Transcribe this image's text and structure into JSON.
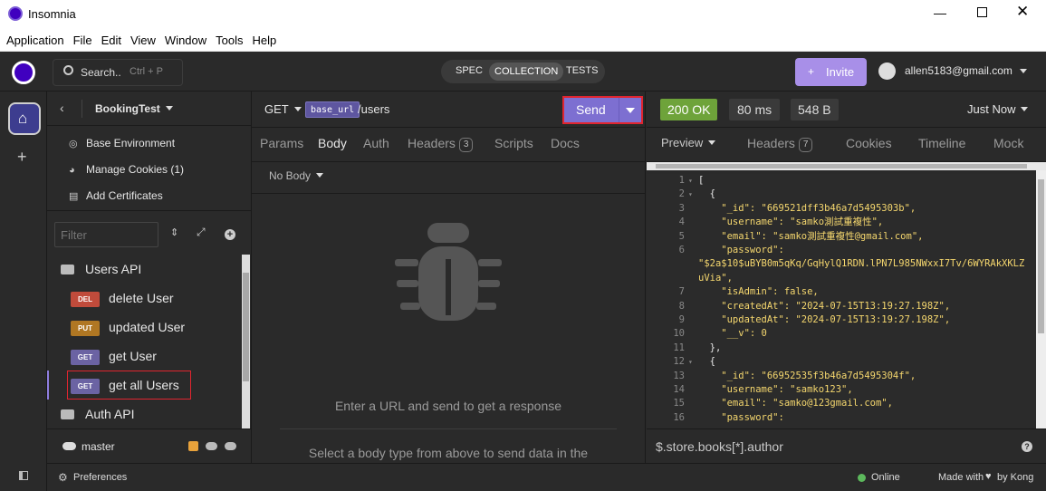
{
  "window": {
    "title": "Insomnia"
  },
  "menu": [
    "Application",
    "File",
    "Edit",
    "View",
    "Window",
    "Tools",
    "Help"
  ],
  "topbar": {
    "search_label": "Search..",
    "search_shortcut": "Ctrl + P",
    "modes": [
      "SPEC",
      "COLLECTION",
      "TESTS"
    ],
    "active_mode": "COLLECTION",
    "invite_label": "Invite",
    "user_email": "allen5183@gmail.com",
    "invite_color": "#a88fe8"
  },
  "sidebar": {
    "project_name": "BookingTest",
    "env_items": [
      {
        "icon": "globe-icon",
        "label": "Base Environment"
      },
      {
        "icon": "cookie-icon",
        "label": "Manage Cookies (1)"
      },
      {
        "icon": "certificate-icon",
        "label": "Add Certificates"
      }
    ],
    "filter_placeholder": "Filter",
    "folders": [
      {
        "name": "Users API",
        "requests": [
          {
            "method": "DEL",
            "name": "delete User"
          },
          {
            "method": "PUT",
            "name": "updated User"
          },
          {
            "method": "GET",
            "name": "get User"
          },
          {
            "method": "GET",
            "name": "get all Users",
            "active": true
          }
        ]
      },
      {
        "name": "Auth API",
        "requests": []
      }
    ],
    "branch": "master"
  },
  "request": {
    "method": "GET",
    "url_var": "base_url",
    "url_path": "/users",
    "send_label": "Send",
    "tabs": [
      {
        "label": "Params"
      },
      {
        "label": "Body",
        "active": true
      },
      {
        "label": "Auth"
      },
      {
        "label": "Headers",
        "count": "3"
      },
      {
        "label": "Scripts"
      },
      {
        "label": "Docs"
      }
    ],
    "body_type": "No Body",
    "empty_title": "Enter a URL and send to get a response",
    "empty_sub": "Select a body type from above to send data in the"
  },
  "response": {
    "status": "200 OK",
    "time": "80 ms",
    "size": "548 B",
    "timestamp": "Just Now",
    "status_color": "#6ea33a",
    "tabs": [
      {
        "label": "Preview",
        "active": true
      },
      {
        "label": "Headers",
        "count": "7"
      },
      {
        "label": "Cookies"
      },
      {
        "label": "Timeline"
      },
      {
        "label": "Mock Res"
      }
    ],
    "filter_query": "$.store.books[*].author",
    "lines": [
      {
        "n": "1",
        "fold": true,
        "text": "["
      },
      {
        "n": "2",
        "fold": true,
        "text": "  {"
      },
      {
        "n": "3",
        "text": "    \"_id\": \"669521dff3b46a7d5495303b\","
      },
      {
        "n": "4",
        "text": "    \"username\": \"samko測試重複性\","
      },
      {
        "n": "5",
        "text": "    \"email\": \"samko測試重複性@gmail.com\","
      },
      {
        "n": "6",
        "text": "    \"password\":"
      },
      {
        "n": "",
        "text": "\"$2a$10$uBYB0m5qKq/GqHylQ1RDN.lPN7L985NWxxI7Tv/6WYRAkXKLZ"
      },
      {
        "n": "",
        "text": "uVia\","
      },
      {
        "n": "7",
        "text": "    \"isAdmin\": false,"
      },
      {
        "n": "8",
        "text": "    \"createdAt\": \"2024-07-15T13:19:27.198Z\","
      },
      {
        "n": "9",
        "text": "    \"updatedAt\": \"2024-07-15T13:19:27.198Z\","
      },
      {
        "n": "10",
        "text": "    \"__v\": 0"
      },
      {
        "n": "11",
        "text": "  },"
      },
      {
        "n": "12",
        "fold": true,
        "text": "  {"
      },
      {
        "n": "13",
        "text": "    \"_id\": \"66952535f3b46a7d5495304f\","
      },
      {
        "n": "14",
        "text": "    \"username\": \"samko123\","
      },
      {
        "n": "15",
        "text": "    \"email\": \"samko@123gmail.com\","
      },
      {
        "n": "16",
        "text": "    \"password\":"
      }
    ]
  },
  "footer": {
    "preferences": "Preferences",
    "status": "Online",
    "made_with": "Made with",
    "by": "by Kong",
    "online_color": "#5cb85c"
  }
}
